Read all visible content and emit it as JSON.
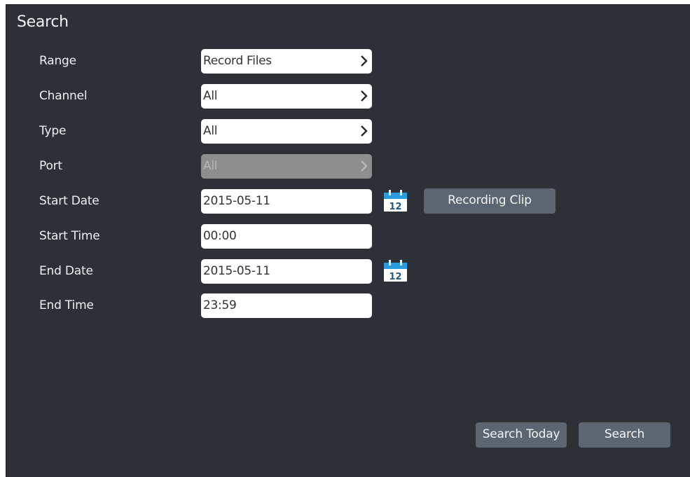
{
  "panel": {
    "title": "Search",
    "bg_color": "#2e3038"
  },
  "form": {
    "range": {
      "label": "Range",
      "value": "Record Files"
    },
    "channel": {
      "label": "Channel",
      "value": "All"
    },
    "type": {
      "label": "Type",
      "value": "All"
    },
    "port": {
      "label": "Port",
      "value": "All",
      "disabled": true
    },
    "start_date": {
      "label": "Start Date",
      "value": "2015-05-11",
      "icon": "calendar-icon"
    },
    "start_time": {
      "label": "Start Time",
      "value": "00:00"
    },
    "end_date": {
      "label": "End Date",
      "value": "2015-05-11",
      "icon": "calendar-icon"
    },
    "end_time": {
      "label": "End Time",
      "value": "23:59"
    },
    "select_icon": "chevron-right-icon"
  },
  "buttons": {
    "recording_clip": "Recording Clip",
    "search_today": "Search Today",
    "search": "Search",
    "color": "#5c6572"
  }
}
